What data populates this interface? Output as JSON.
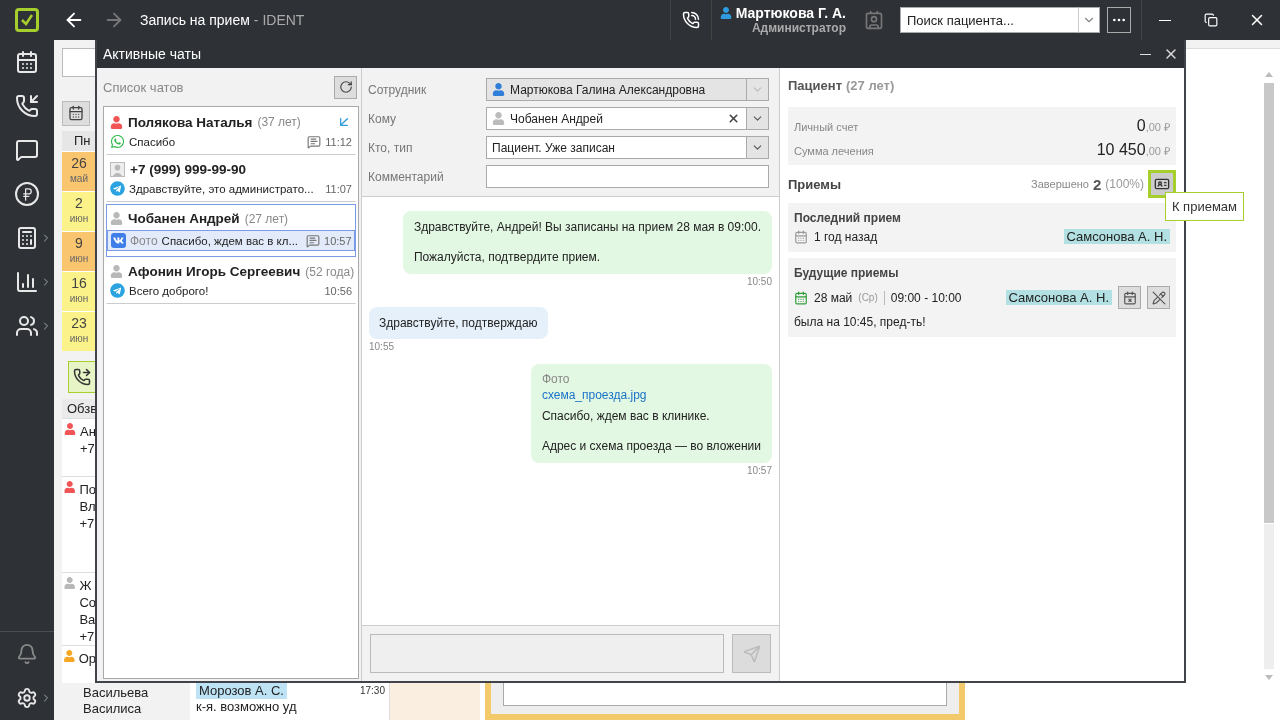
{
  "topbar": {
    "title": "Запись на прием",
    "app_suffix": "- IDENT",
    "user": {
      "name": "Мартюкова Г. А.",
      "role": "Администратор"
    },
    "patient_search": {
      "placeholder": "Поиск пациента..."
    }
  },
  "background": {
    "calendar": {
      "header": "Пн",
      "days": [
        {
          "day": "26",
          "month": "май",
          "color": "#f9c56e"
        },
        {
          "day": "2",
          "month": "июн",
          "color": "#fbf28a"
        },
        {
          "day": "9",
          "month": "июн",
          "color": "#f9c56e"
        },
        {
          "day": "16",
          "month": "июн",
          "color": "#fbf28a"
        },
        {
          "day": "23",
          "month": "июн",
          "color": "#fbf28a"
        }
      ]
    },
    "call_list": {
      "header": "Обзв",
      "rows": [
        {
          "lines": [
            "Ан",
            "+7"
          ],
          "color": "#f05454"
        },
        {
          "lines": [
            "По",
            "Вл",
            "+7"
          ],
          "color": "#f05454"
        },
        {
          "lines": [
            "Ж",
            "Со",
            "Ва",
            "+7"
          ],
          "color": "#b8b8b8"
        },
        {
          "lines": [
            "Ор"
          ],
          "color": "#f5a623"
        }
      ]
    },
    "bottom_row": {
      "patient_lines": [
        "Васильева",
        "Василиса"
      ],
      "doctor": "Морозов А. С.",
      "note": "к-я. возможно уд",
      "time": "17:30"
    }
  },
  "dialog": {
    "title": "Активные чаты",
    "chat_list": {
      "title": "Список чатов",
      "chats": [
        {
          "name": "Полякова Наталья",
          "age": "(37 лет)",
          "avatar": {
            "kind": "person",
            "color": "#f05454"
          },
          "channel": {
            "kind": "whatsapp"
          },
          "message": "Спасибо",
          "time": "11:12",
          "comment": true,
          "arrow": true,
          "selected": false
        },
        {
          "name": "+7 (999) 999-99-90",
          "avatar": {
            "kind": "contact",
            "color": "#b8b8b8"
          },
          "channel": {
            "kind": "telegram"
          },
          "message": "Здравствуйте, это администрато...",
          "time": "11:07",
          "comment": false,
          "arrow": false,
          "selected": false
        },
        {
          "name": "Чобанен Андрей",
          "age": "(27 лет)",
          "avatar": {
            "kind": "person",
            "color": "#b8b8b8"
          },
          "channel": {
            "kind": "vk"
          },
          "prefix": "Фото",
          "message": "Спасибо, ждем вас в кл...",
          "time": "10:57",
          "comment": true,
          "arrow": false,
          "selected": true
        },
        {
          "name": "Афонин Игорь Сергеевич",
          "age": "(52 года)",
          "avatar": {
            "kind": "person",
            "color": "#b8b8b8"
          },
          "channel": {
            "kind": "telegram"
          },
          "message": "Всего доброго!",
          "time": "10:56",
          "comment": false,
          "arrow": false,
          "selected": false
        }
      ]
    },
    "form": [
      {
        "label": "Сотрудник",
        "kind": "combo",
        "value": "Мартюкова Галина Александровна",
        "disabled": true,
        "clearable": false
      },
      {
        "label": "Кому",
        "kind": "combo",
        "value": "Чобанен Андрей",
        "disabled": false,
        "clearable": true
      },
      {
        "label": "Кто, тип",
        "kind": "combo",
        "value": "Пациент. Уже записан",
        "disabled": false,
        "clearable": false
      },
      {
        "label": "Комментарий",
        "kind": "text",
        "disabled": false,
        "clearable": false
      }
    ],
    "messages": [
      {
        "kind": "outgoing",
        "paragraphs": [
          "Здравствуйте, Андрей! Вы записаны на прием 28 мая в 09:00.",
          "Пожалуйста, подтвердите прием."
        ],
        "time": "10:50"
      },
      {
        "kind": "incoming",
        "paragraphs": [
          "Здравствуйте, подтверждаю"
        ],
        "time": "10:55"
      },
      {
        "kind": "outgoing",
        "caption": "Фото",
        "attachment": "схема_проезда.jpg",
        "paragraphs": [
          "Спасибо, ждем вас в клинике.",
          "Адрес и схема проезда — во вложении"
        ],
        "time": "10:57"
      }
    ],
    "composer": {
      "send_disabled": true
    },
    "patient": {
      "title": "Пациент",
      "age": "(27 лет)",
      "balances": [
        {
          "label": "Личный счет",
          "amount": "0",
          "cents": ",00 ₽"
        },
        {
          "label": "Сумма лечения",
          "amount": "10 450",
          "cents": ",00 ₽"
        }
      ],
      "appointments": {
        "title": "Приемы",
        "completed_label": "Завершено",
        "completed_count": "2",
        "completed_pct": "(100%)",
        "button_highlighted": true,
        "tooltip": "К приемам",
        "last": {
          "title": "Последний прием",
          "when": "1 год назад",
          "doctor": "Самсонова А. Н."
        },
        "future": {
          "title": "Будущие приемы",
          "items": [
            {
              "date": "28 май",
              "weekday": "(Ср)",
              "time": "09:00 - 10:00",
              "doctor": "Самсонова А. Н.",
              "note": "была на 10:45, пред-ть!"
            }
          ]
        }
      }
    }
  }
}
